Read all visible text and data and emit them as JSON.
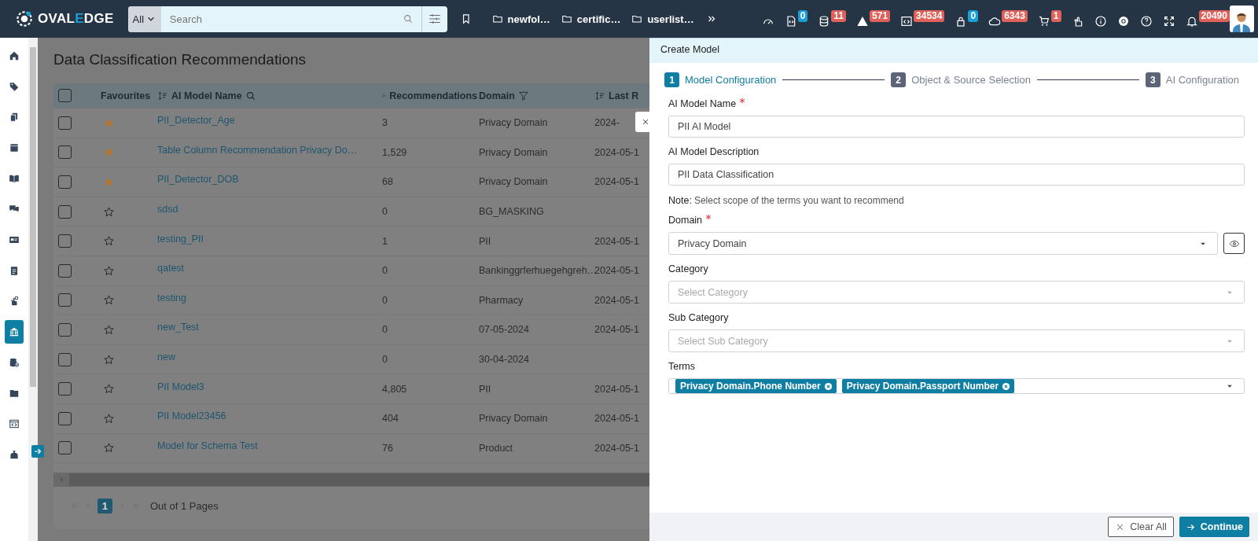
{
  "topbar": {
    "logo": [
      "OVAL",
      "E",
      "DGE"
    ],
    "search": {
      "scope": "All",
      "placeholder": "Search"
    },
    "folders": [
      "newfol…",
      "certific…",
      "userlist…"
    ],
    "status_icons": [
      {
        "kind": "plain"
      },
      {
        "kind": "counter",
        "badge": "0",
        "color": "#1a9fd6"
      },
      {
        "kind": "counter",
        "badge": "11",
        "color": "#e0605a"
      },
      {
        "kind": "counter",
        "badge": "571",
        "color": "#e0605a"
      },
      {
        "kind": "counter",
        "badge": "34534",
        "color": "#e0605a"
      },
      {
        "kind": "counter",
        "badge": "0",
        "color": "#1a9fd6"
      },
      {
        "kind": "counter",
        "badge": "6343",
        "color": "#e0605a"
      },
      {
        "kind": "counter",
        "badge": "1",
        "color": "#e0605a"
      },
      {
        "kind": "plain"
      },
      {
        "kind": "plain"
      },
      {
        "kind": "plain"
      },
      {
        "kind": "plain"
      },
      {
        "kind": "plain"
      },
      {
        "kind": "counter",
        "badge": "20490",
        "color": "#e0605a"
      }
    ]
  },
  "sidebar": {
    "items": [
      {
        "selected": false
      },
      {
        "selected": false
      },
      {
        "selected": false
      },
      {
        "selected": false
      },
      {
        "selected": false
      },
      {
        "selected": false
      },
      {
        "selected": false
      },
      {
        "selected": false
      },
      {
        "selected": false
      },
      {
        "selected": true
      },
      {
        "selected": false
      },
      {
        "selected": false
      },
      {
        "selected": false
      },
      {
        "selected": false
      }
    ]
  },
  "page": {
    "title": "Data Classification Recommendations",
    "table": {
      "all_checked": false,
      "columns": [
        "Favourites",
        "AI Model Name",
        "Recommendations",
        "Domain",
        "Last R"
      ],
      "rows": [
        {
          "checked": false,
          "favourite": true,
          "name": "PII_Detector_Age",
          "recommendations": "3",
          "domain": "Privacy Domain",
          "last_run": "2024-"
        },
        {
          "checked": false,
          "favourite": true,
          "name": "Table Column Recommendation Privacy Do…",
          "recommendations": "1,529",
          "domain": "Privacy Domain",
          "last_run": "2024-05-1"
        },
        {
          "checked": false,
          "favourite": true,
          "name": "PII_Detector_DOB",
          "recommendations": "68",
          "domain": "Privacy Domain",
          "last_run": "2024-05-1"
        },
        {
          "checked": false,
          "favourite": false,
          "name": "sdsd",
          "recommendations": "0",
          "domain": "BG_MASKING"
        },
        {
          "checked": false,
          "favourite": false,
          "name": "testing_PII",
          "recommendations": "1",
          "domain": "PII",
          "last_run": "2024-05-1"
        },
        {
          "checked": false,
          "favourite": false,
          "name": "qatest",
          "recommendations": "0",
          "domain": "Bankinggrferhuegehgreh…",
          "last_run": "2024-05-1"
        },
        {
          "checked": false,
          "favourite": false,
          "name": "testing",
          "recommendations": "0",
          "domain": "Pharmacy",
          "last_run": "2024-05-1"
        },
        {
          "checked": false,
          "favourite": false,
          "name": "new_Test",
          "recommendations": "0",
          "domain": "07-05-2024",
          "last_run": "2024-05-1"
        },
        {
          "checked": false,
          "favourite": false,
          "name": "new",
          "recommendations": "0",
          "domain": "30-04-2024"
        },
        {
          "checked": false,
          "favourite": false,
          "name": "PII Model3",
          "recommendations": "4,805",
          "domain": "PII",
          "last_run": "2024-05-1"
        },
        {
          "checked": false,
          "favourite": false,
          "name": "PII Model23456",
          "recommendations": "404",
          "domain": "Privacy Domain",
          "last_run": "2024-05-1"
        },
        {
          "checked": false,
          "favourite": false,
          "name": "Model for Schema Test",
          "recommendations": "76",
          "domain": "Product",
          "last_run": "2024-05-1"
        }
      ]
    },
    "pagination": {
      "pages": [
        {
          "label": "1",
          "selected": true
        }
      ],
      "summary": "Out of 1 Pages"
    }
  },
  "panel": {
    "title": "Create Model",
    "steps": [
      {
        "number": "1",
        "label": "Model Configuration",
        "selected": true
      },
      {
        "number": "2",
        "label": "Object & Source Selection",
        "selected": false
      },
      {
        "number": "3",
        "label": "AI Configuration",
        "selected": false
      }
    ],
    "fields": [
      {
        "kind": "text",
        "label": "AI Model Name",
        "required": true,
        "value": "PII AI Model"
      },
      {
        "kind": "text",
        "label": "AI Model Description",
        "required": false,
        "value": "PII Data Classification"
      },
      {
        "kind": "note",
        "label": "Note:",
        "text": "Select scope of the terms you want to recommend"
      },
      {
        "kind": "select",
        "label": "Domain",
        "required": true,
        "value": "Privacy Domain",
        "preview": true
      },
      {
        "kind": "select",
        "label": "Category",
        "required": false,
        "placeholder": "Select Category"
      },
      {
        "kind": "select",
        "label": "Sub Category",
        "required": false,
        "placeholder": "Select Sub Category"
      },
      {
        "kind": "tags",
        "label": "Terms",
        "required": false,
        "tags": [
          "Privacy Domain.Phone Number",
          "Privacy Domain.Passport Number"
        ]
      }
    ],
    "buttons": [
      {
        "kind": "secondary",
        "label": "Clear All"
      },
      {
        "kind": "primary",
        "label": "Continue"
      }
    ]
  }
}
